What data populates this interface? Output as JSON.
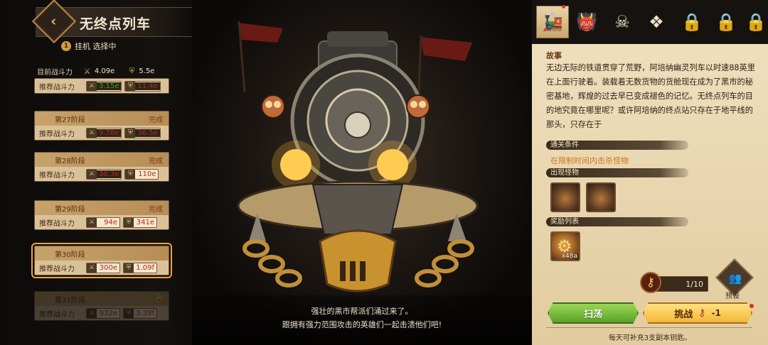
{
  "header": {
    "title": "无终点列车",
    "afk_num": "1",
    "afk_text": "挂机 选择中"
  },
  "current_power": {
    "label": "目前战斗力",
    "attack": "4.09e",
    "defense": "5.5e"
  },
  "first_recommend": {
    "label": "推荐战斗力",
    "attack": "3.15e",
    "defense": "11.4e"
  },
  "stages": [
    {
      "name": "第27阶段",
      "status": "完成",
      "rec_label": "推荐战斗力",
      "attack": "9.78e",
      "defense": "36.5e"
    },
    {
      "name": "第28阶段",
      "status": "完成",
      "rec_label": "推荐战斗力",
      "attack": "30.3e",
      "defense": "110e"
    },
    {
      "name": "第29阶段",
      "status": "完成",
      "rec_label": "推荐战斗力",
      "attack": "94e",
      "defense": "341e"
    },
    {
      "name": "第30阶段",
      "status": "",
      "rec_label": "推荐战斗力",
      "attack": "300e",
      "defense": "1.09f"
    },
    {
      "name": "第31阶段",
      "status": "",
      "rec_label": "推荐战斗力",
      "attack": "932e",
      "defense": "3.39f"
    }
  ],
  "dialog": {
    "line1": "强壮的黑市帮派们涌过来了。",
    "line2": "跟拥有强力范围攻击的英雄们一起击溃他们吧!"
  },
  "tabs": [
    {
      "icon": "train-icon"
    },
    {
      "icon": "demon-icon"
    },
    {
      "icon": "skull-icon"
    },
    {
      "icon": "crystal-icon"
    },
    {
      "icon": "locked-tab-icon"
    },
    {
      "icon": "locked-tab-icon"
    },
    {
      "icon": "locked-tab-icon"
    }
  ],
  "story": {
    "title": "故事",
    "text": "无边无际的铁道贯穿了荒野，阿培纳幽灵列车以时速88英里在上面行驶着。装载着无数货物的货舱现在成为了黑市的秘密基地，辉煌的过去早已变成褪色的记忆。无终点列车的目的地究竟在哪里呢？或许阿培纳的终点站只存在于地平线的那头，只存在于"
  },
  "clear_condition": {
    "header": "通关条件",
    "text": "在限制时间内击杀怪物"
  },
  "monsters_header": "出现怪物",
  "rewards": {
    "header": "奖励列表",
    "count": "x48a"
  },
  "keys": {
    "count": "1/10"
  },
  "preset_label": "预设",
  "buttons": {
    "sweep": "扫荡",
    "challenge": "挑战",
    "challenge_cost": "-1"
  },
  "daily_note": "每天可补充3支副本钥匙。",
  "colors": {
    "accent_gold": "#e9b25a",
    "panel_bg": "#f0e1c1",
    "sweep_green": "#5aa32a",
    "challenge_yellow": "#f4b63a"
  }
}
